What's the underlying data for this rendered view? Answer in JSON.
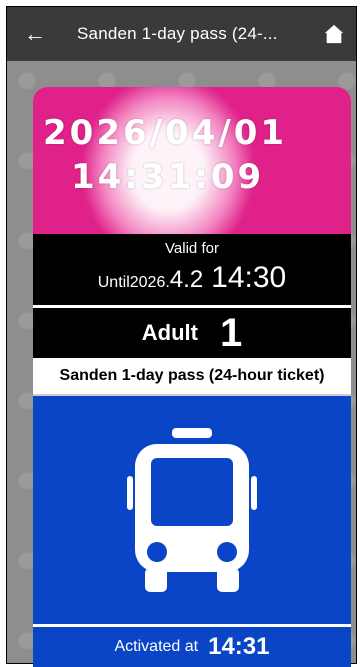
{
  "appbar": {
    "title": "Sanden 1-day pass (24-...",
    "back_icon": "arrow-left-icon",
    "home_icon": "home-icon"
  },
  "ticket": {
    "issued_date": "2026/04/01",
    "issued_time": "14:31:09",
    "valid_label": "Valid for",
    "valid_until_prefix": "Until2026.",
    "valid_until_date": "4.2",
    "valid_until_time": "14:30",
    "passenger_type": "Adult",
    "passenger_count": "1",
    "product_name": "Sanden 1-day pass (24-hour ticket)",
    "bus_icon": "bus-icon",
    "activated_label": "Activated at",
    "activated_time": "14:31"
  },
  "colors": {
    "appbar": "#3a3a3a",
    "magenta": "#e0218a",
    "blue": "#0a44c7",
    "black": "#000000"
  }
}
